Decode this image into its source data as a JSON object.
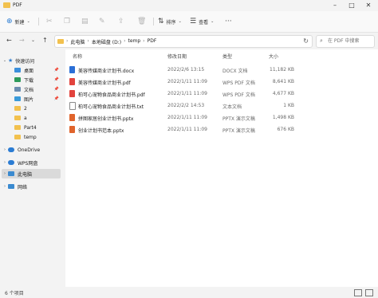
{
  "window": {
    "title": "PDF"
  },
  "toolbar": {
    "new_label": "新建",
    "sort_label": "排序",
    "view_label": "查看",
    "more": "···"
  },
  "address": {
    "crumbs": [
      "此电脑",
      "本地磁盘 (D:)",
      "temp",
      "PDF"
    ],
    "search_placeholder": "在 PDF 中搜索"
  },
  "sidebar": {
    "items": [
      {
        "label": "快速访问",
        "icon": "star-icon",
        "color": "#2f7dd1"
      },
      {
        "label": "桌面",
        "icon": "desktop-icon",
        "color": "#3b8fdb"
      },
      {
        "label": "下载",
        "icon": "download-icon",
        "color": "#2d9a5a"
      },
      {
        "label": "文档",
        "icon": "document-icon",
        "color": "#6c8db0"
      },
      {
        "label": "图片",
        "icon": "picture-icon",
        "color": "#3a9ad9"
      },
      {
        "label": "2",
        "icon": "folder-icon",
        "color": "#f2c14e"
      },
      {
        "label": "a",
        "icon": "folder-icon",
        "color": "#f2c14e"
      },
      {
        "label": "Part4",
        "icon": "folder-icon",
        "color": "#f2c14e"
      },
      {
        "label": "temp",
        "icon": "folder-icon",
        "color": "#f2c14e"
      },
      {
        "label": "OneDrive",
        "icon": "cloud-icon",
        "color": "#2b7cd3"
      },
      {
        "label": "WPS网盘",
        "icon": "cloud-icon",
        "color": "#2b7cd3"
      },
      {
        "label": "此电脑",
        "icon": "computer-icon",
        "color": "#3a8ad0"
      },
      {
        "label": "网络",
        "icon": "network-icon",
        "color": "#3a8ad0"
      }
    ]
  },
  "columns": {
    "name": "名称",
    "modified": "修改日期",
    "type": "类型",
    "size": "大小"
  },
  "files": [
    {
      "name": "美容传媒商业计划书.docx",
      "modified": "2022/2/6 13:15",
      "type": "DOCX 文档",
      "size": "11,182 KB",
      "icon": "word-icon",
      "color": "#2b6fd6"
    },
    {
      "name": "美容传媒商业计划书.pdf",
      "modified": "2022/1/11 11:09",
      "type": "WPS PDF 文档",
      "size": "8,641 KB",
      "icon": "pdf-icon",
      "color": "#e2433d"
    },
    {
      "name": "柏可心宠物食品商业计划书.pdf",
      "modified": "2022/1/11 11:09",
      "type": "WPS PDF 文档",
      "size": "4,677 KB",
      "icon": "pdf-icon",
      "color": "#e2433d"
    },
    {
      "name": "柏可心宠物食品商业计划书.txt",
      "modified": "2022/2/2 14:53",
      "type": "文本文档",
      "size": "1 KB",
      "icon": "text-icon",
      "color": "#8a8a8a"
    },
    {
      "name": "拼图家居创业计划书.pptx",
      "modified": "2022/1/11 11:09",
      "type": "PPTX 演示文稿",
      "size": "1,498 KB",
      "icon": "ppt-icon",
      "color": "#e0642c"
    },
    {
      "name": "创业计划书范本.pptx",
      "modified": "2022/1/11 11:09",
      "type": "PPTX 演示文稿",
      "size": "676 KB",
      "icon": "ppt-icon",
      "color": "#e0642c"
    }
  ],
  "status": {
    "count_text": "6 个项目"
  }
}
